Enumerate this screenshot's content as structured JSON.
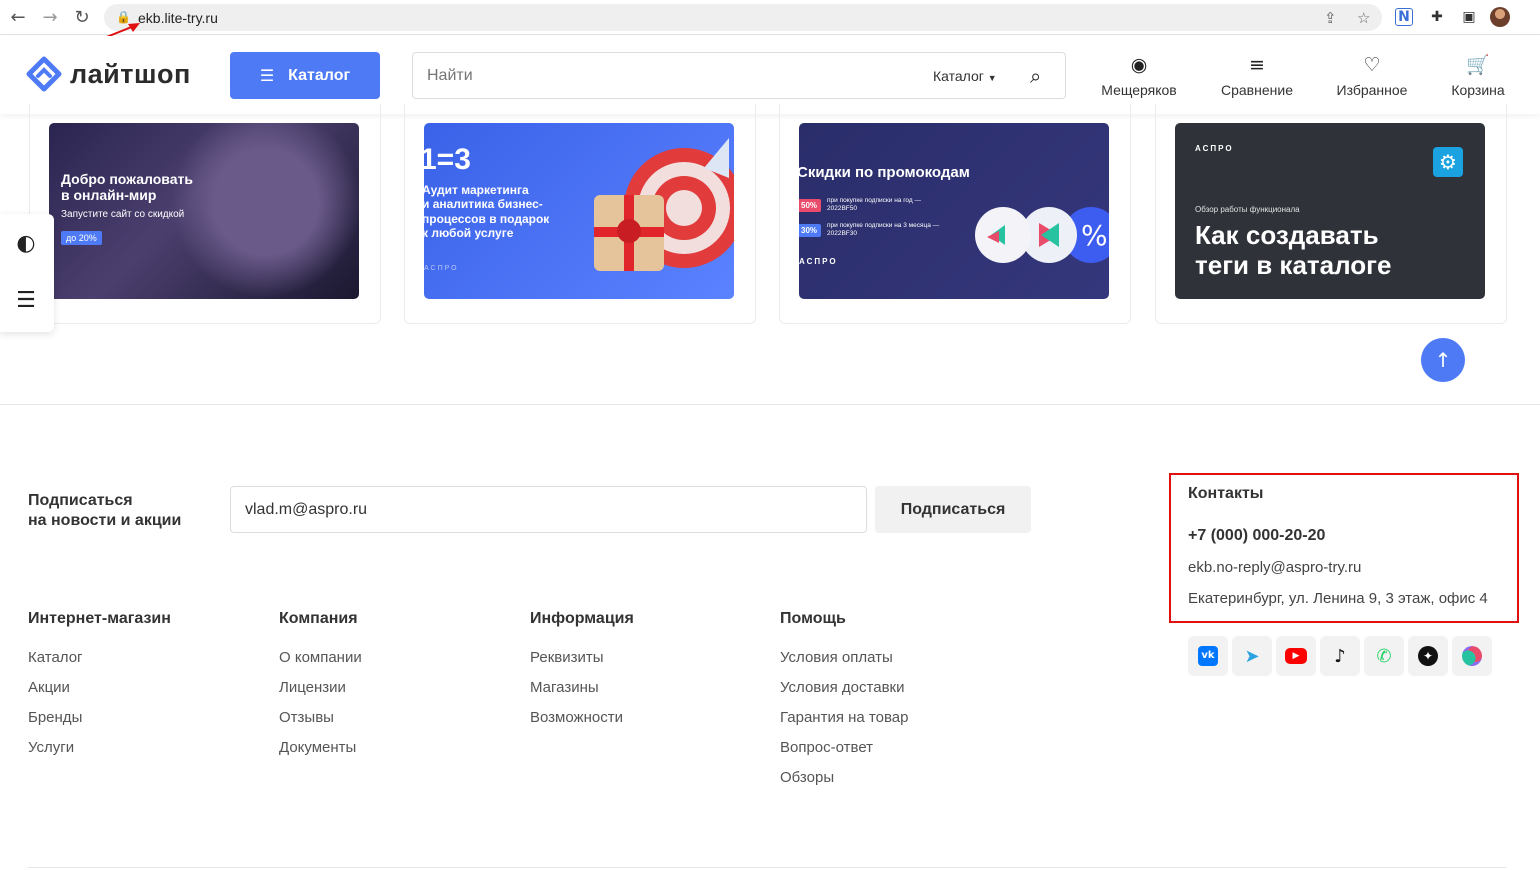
{
  "browser": {
    "url": "ekb.lite-try.ru",
    "back_icon": "arrow-left-icon",
    "forward_icon": "arrow-right-icon",
    "reload_icon": "reload-icon"
  },
  "header": {
    "logo_text": "лайтшоп",
    "catalog_label": "Каталог",
    "search_placeholder": "Найти",
    "search_scope": "Каталог",
    "nav": [
      {
        "label": "Мещеряков",
        "icon": "user-icon"
      },
      {
        "label": "Сравнение",
        "icon": "compare-icon"
      },
      {
        "label": "Избранное",
        "icon": "heart-icon"
      },
      {
        "label": "Корзина",
        "icon": "cart-icon"
      }
    ]
  },
  "banners": [
    {
      "title_line1": "Добро пожаловать",
      "title_line2": "в онлайн-мир",
      "subtitle": "Запустите сайт со скидкой",
      "badge": "до 20%"
    },
    {
      "headline": "1=3",
      "line1": "Аудит маркетинга",
      "line2": "и аналитика бизнес-",
      "line3": "процессов в подарок",
      "line4": "к любой услуге",
      "brand": "АСПРО"
    },
    {
      "title": "Скидки по промокодам",
      "promo1_pct": "50%",
      "promo1_text": "при покупке подписки на год — 2022BF50",
      "promo2_pct": "30%",
      "promo2_text": "при покупке подписки на 3 месяца — 2022BF30",
      "brand": "АСПРО"
    },
    {
      "brand": "АСПРО",
      "caption": "Обзор работы функционала",
      "title_line1": "Как создавать",
      "title_line2": "теги в каталоге"
    }
  ],
  "subscribe": {
    "label_line1": "Подписаться",
    "label_line2": "на новости и акции",
    "email_value": "vlad.m@aspro.ru",
    "button_label": "Подписаться"
  },
  "footer": {
    "columns": [
      {
        "title": "Интернет-магазин",
        "links": [
          "Каталог",
          "Акции",
          "Бренды",
          "Услуги"
        ]
      },
      {
        "title": "Компания",
        "links": [
          "О компании",
          "Лицензии",
          "Отзывы",
          "Документы"
        ]
      },
      {
        "title": "Информация",
        "links": [
          "Реквизиты",
          "Магазины",
          "Возможности"
        ]
      },
      {
        "title": "Помощь",
        "links": [
          "Условия оплаты",
          "Условия доставки",
          "Гарантия на товар",
          "Вопрос-ответ",
          "Обзоры"
        ]
      }
    ],
    "contacts": {
      "title": "Контакты",
      "phone": "+7 (000) 000-20-20",
      "email": "ekb.no-reply@aspro-try.ru",
      "address": "Екатеринбург, ул. Ленина 9, 3 этаж, офис 4"
    },
    "socials": [
      "vk-icon",
      "telegram-icon",
      "youtube-icon",
      "tiktok-icon",
      "whatsapp-icon",
      "zen-icon",
      "odnoklassniki-icon"
    ]
  },
  "colors": {
    "accent": "#4e7bf5",
    "highlight": "#e01010"
  }
}
